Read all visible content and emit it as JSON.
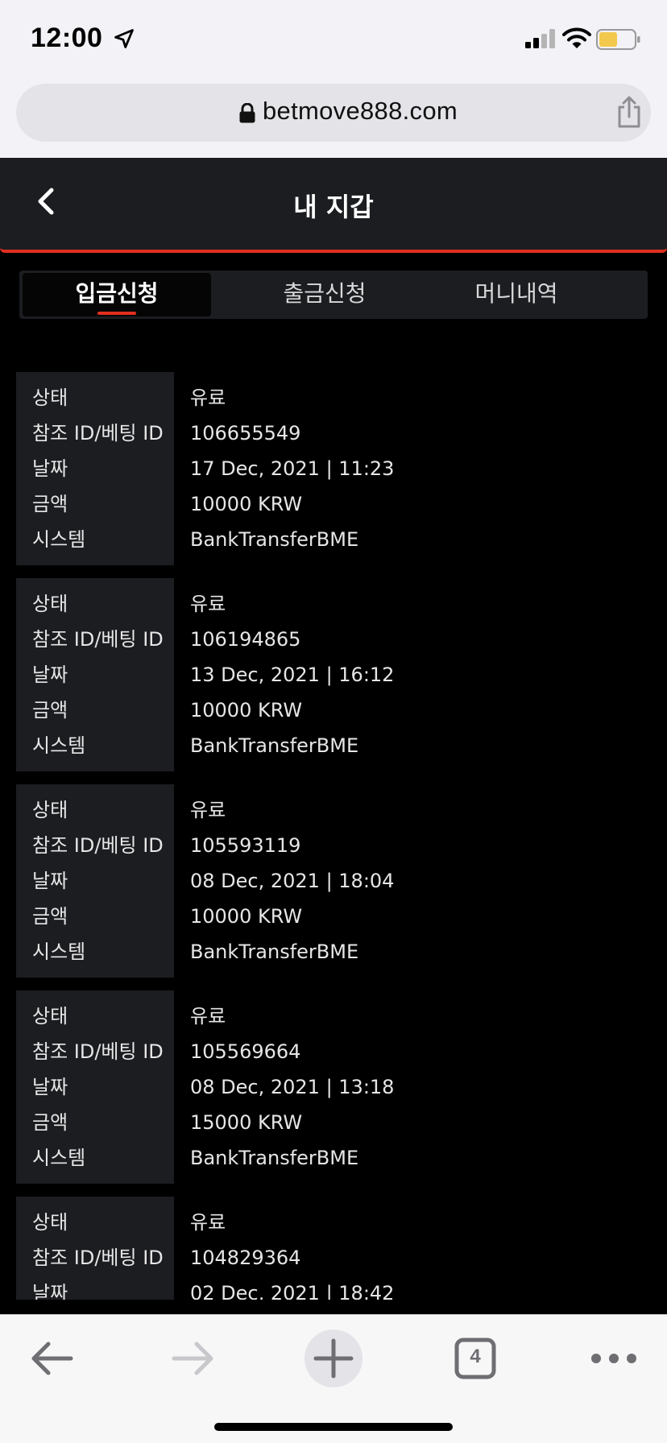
{
  "status_bar": {
    "time": "12:00",
    "icons": [
      "location-arrow-icon",
      "signal-icon",
      "wifi-icon",
      "battery-icon"
    ]
  },
  "browser": {
    "url": "betmove888.com",
    "tab_count": "4"
  },
  "header": {
    "title": "내 지갑"
  },
  "tabs": [
    {
      "label": "입금신청",
      "active": true
    },
    {
      "label": "출금신청",
      "active": false
    },
    {
      "label": "머니내역",
      "active": false
    }
  ],
  "labels": {
    "status": "상태",
    "ref_id": "참조 ID/베팅 ID",
    "date": "날짜",
    "amount": "금액",
    "system": "시스템"
  },
  "records": [
    {
      "status": "유료",
      "ref_id": "106655549",
      "date": "17 Dec, 2021 | 11:23",
      "amount": "10000 KRW",
      "system": "BankTransferBME"
    },
    {
      "status": "유료",
      "ref_id": "106194865",
      "date": "13 Dec, 2021 | 16:12",
      "amount": "10000 KRW",
      "system": "BankTransferBME"
    },
    {
      "status": "유료",
      "ref_id": "105593119",
      "date": "08 Dec, 2021 | 18:04",
      "amount": "10000 KRW",
      "system": "BankTransferBME"
    },
    {
      "status": "유료",
      "ref_id": "105569664",
      "date": "08 Dec, 2021 | 13:18",
      "amount": "15000 KRW",
      "system": "BankTransferBME"
    },
    {
      "status": "유료",
      "ref_id": "104829364",
      "date": "02 Dec, 2021 | 18:42",
      "amount": "",
      "system": ""
    }
  ],
  "colors": {
    "accent": "#e0301e",
    "panel": "#1c1d21",
    "background": "#000000"
  }
}
